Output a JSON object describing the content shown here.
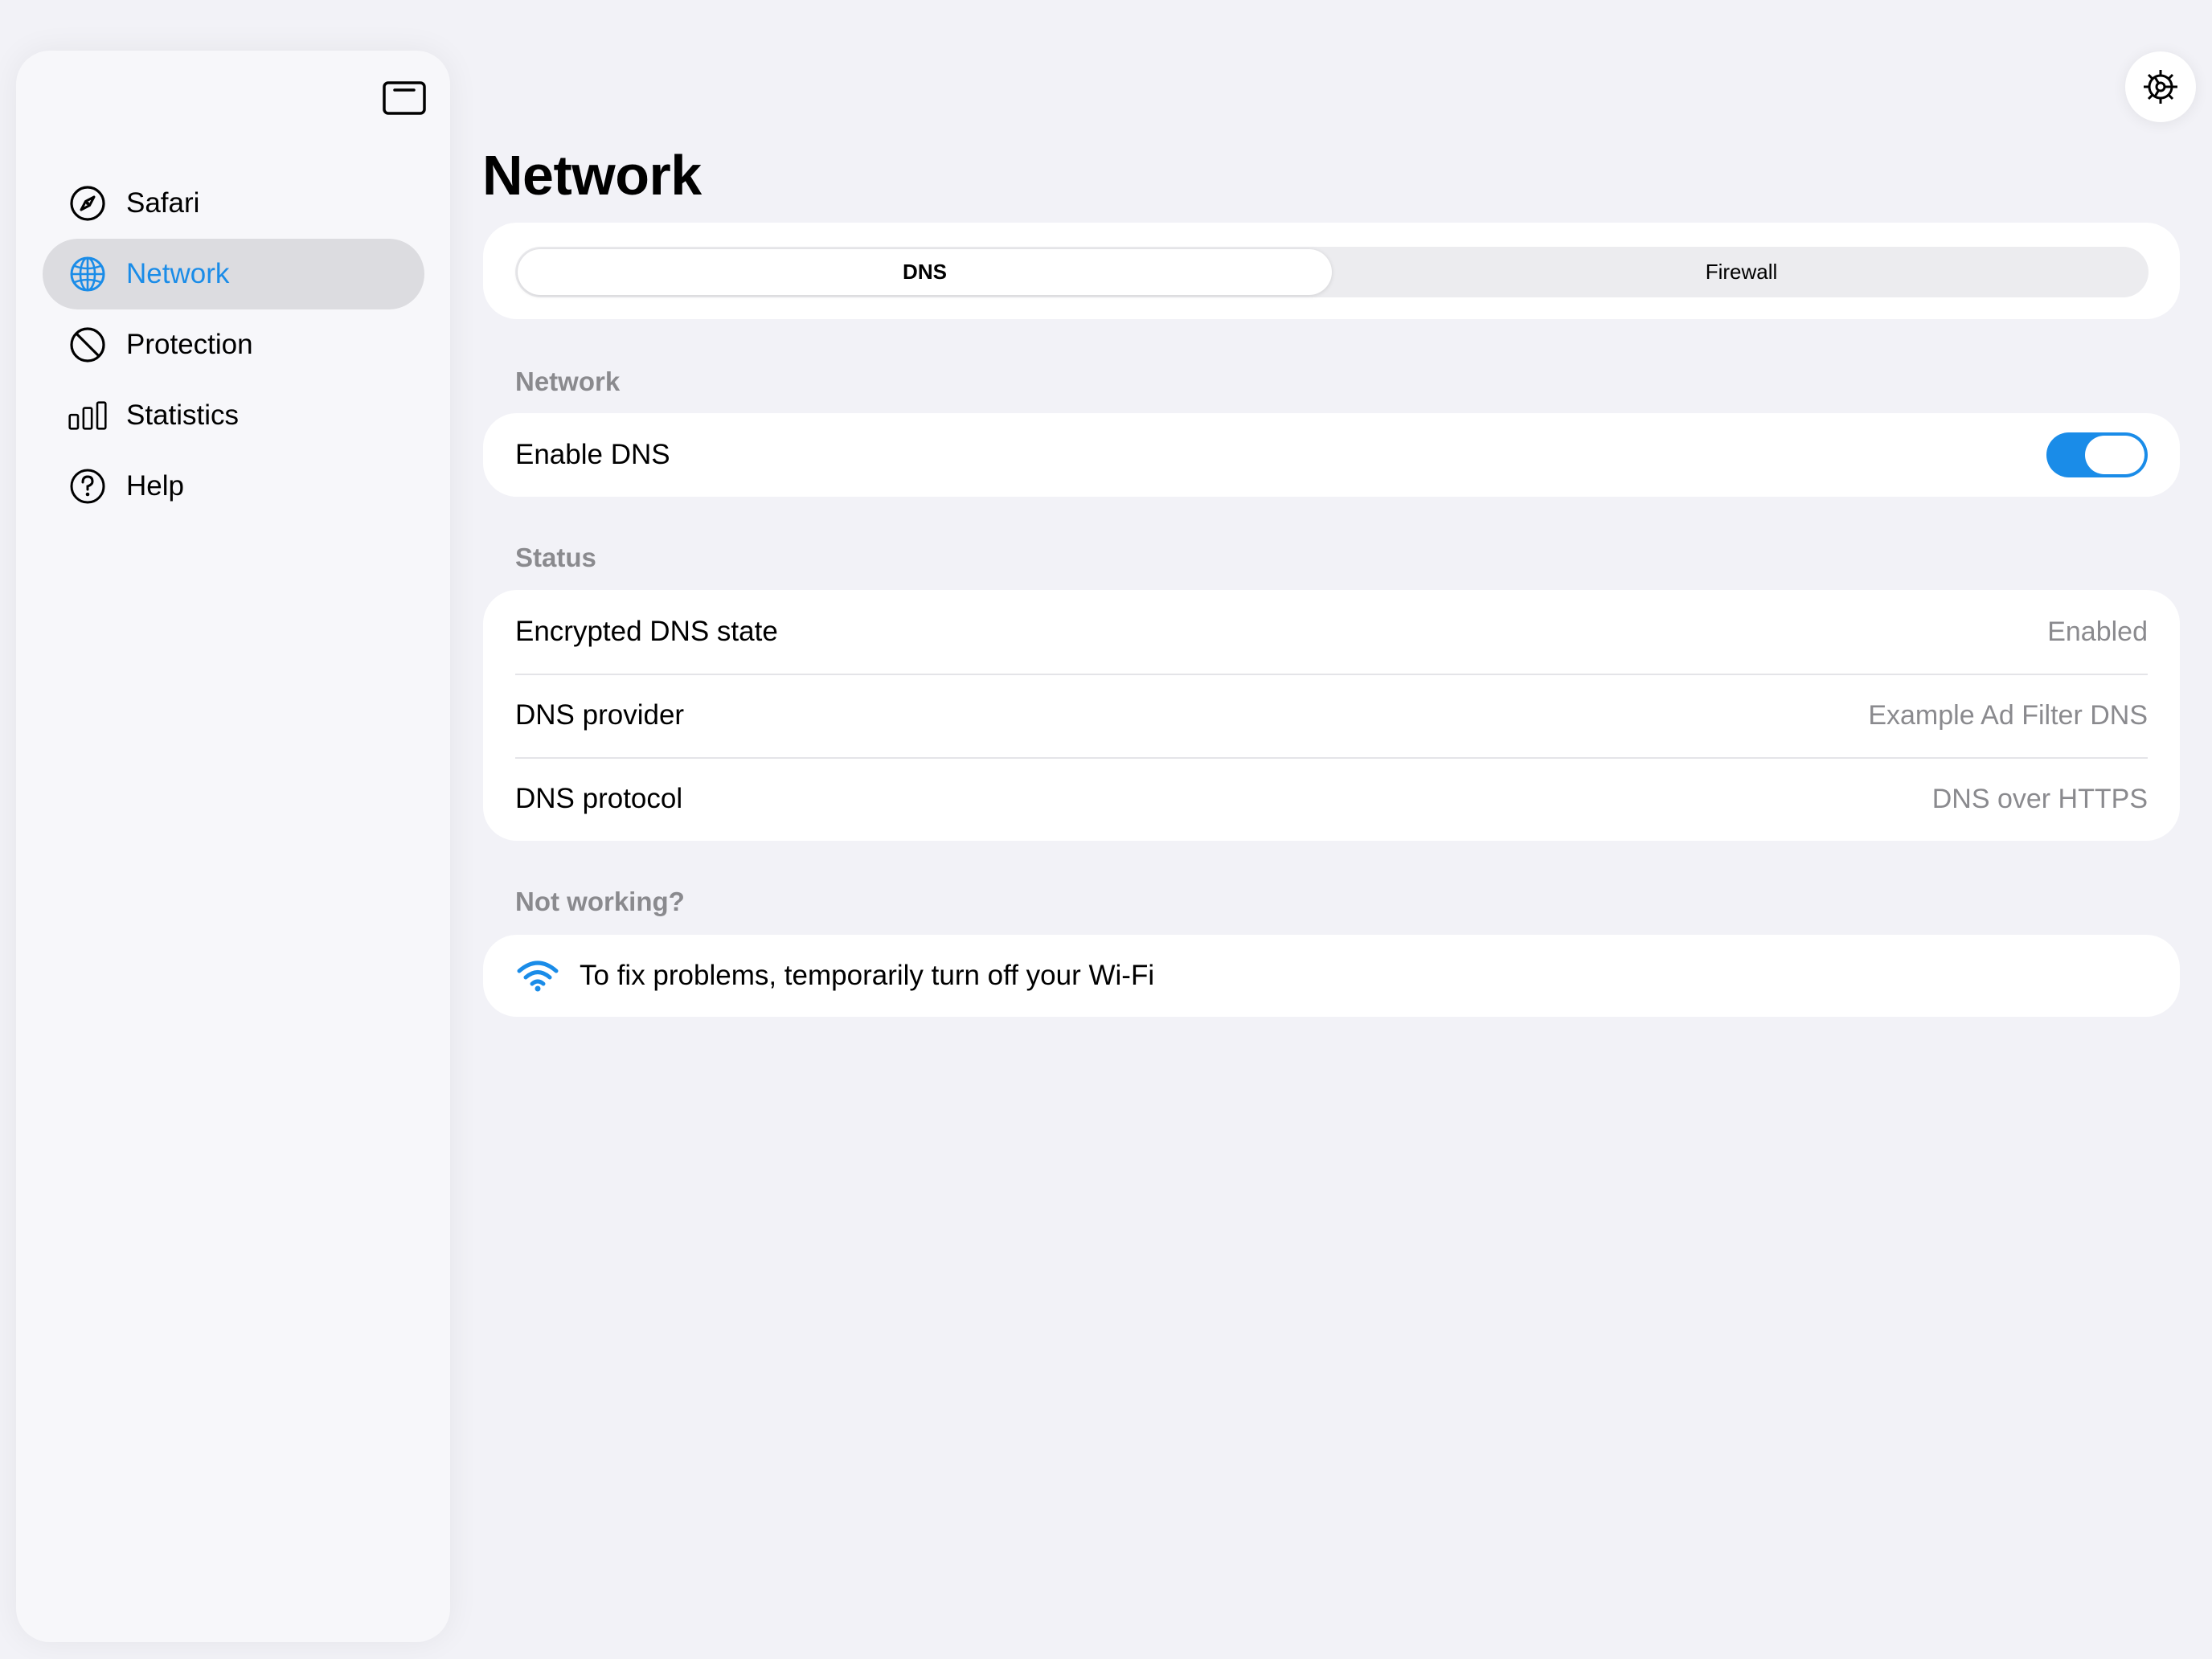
{
  "sidebar": {
    "items": [
      {
        "label": "Safari",
        "icon": "compass-icon",
        "active": false
      },
      {
        "label": "Network",
        "icon": "globe-icon",
        "active": true
      },
      {
        "label": "Protection",
        "icon": "prohibit-icon",
        "active": false
      },
      {
        "label": "Statistics",
        "icon": "bar-chart-icon",
        "active": false
      },
      {
        "label": "Help",
        "icon": "question-icon",
        "active": false
      }
    ]
  },
  "page": {
    "title": "Network"
  },
  "tabs": [
    {
      "label": "DNS",
      "selected": true
    },
    {
      "label": "Firewall",
      "selected": false
    }
  ],
  "network_section": {
    "header": "Network",
    "enable_dns_label": "Enable DNS",
    "enable_dns_on": true
  },
  "status_section": {
    "header": "Status",
    "rows": [
      {
        "label": "Encrypted DNS state",
        "value": "Enabled"
      },
      {
        "label": "DNS provider",
        "value": "Example Ad Filter DNS"
      },
      {
        "label": "DNS protocol",
        "value": "DNS over HTTPS"
      }
    ]
  },
  "help_section": {
    "header": "Not working?",
    "tip": "To fix problems, temporarily turn off your Wi-Fi"
  },
  "colors": {
    "accent": "#1a8ce8",
    "background": "#f2f2f7",
    "secondary_text": "#8a8a8e"
  }
}
